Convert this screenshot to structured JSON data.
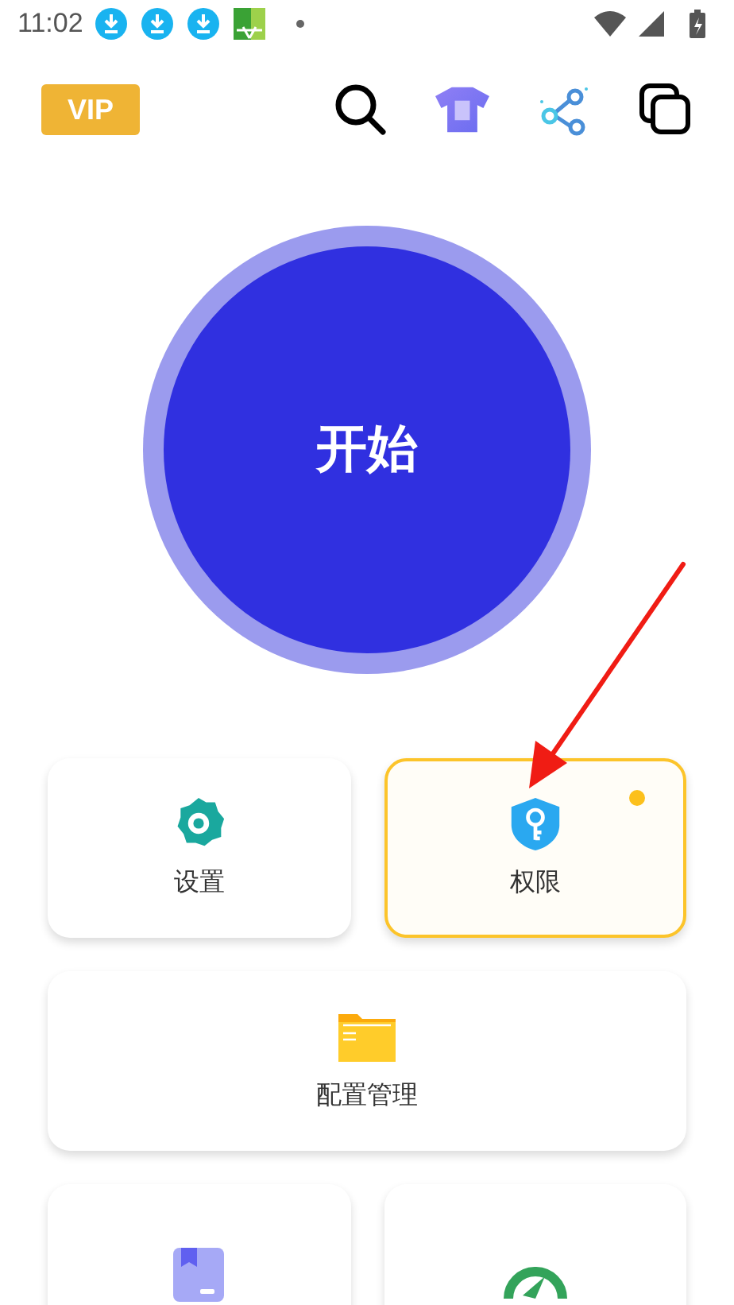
{
  "status_bar": {
    "time": "11:02"
  },
  "toolbar": {
    "vip_label": "VIP"
  },
  "start_button": {
    "label": "开始"
  },
  "cards": [
    {
      "label": "设置",
      "highlighted": false,
      "badge": false,
      "wide": false
    },
    {
      "label": "权限",
      "highlighted": true,
      "badge": true,
      "wide": false
    },
    {
      "label": "配置管理",
      "highlighted": false,
      "badge": false,
      "wide": true
    },
    {
      "highlighted": false,
      "badge": false,
      "wide": false
    },
    {
      "highlighted": false,
      "badge": false,
      "wide": false
    }
  ]
}
